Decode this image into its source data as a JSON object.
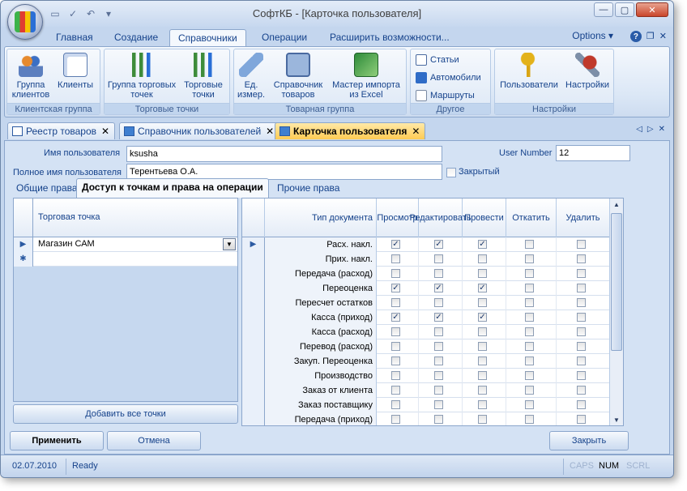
{
  "window": {
    "title": "СофтКБ - [Карточка пользователя]",
    "buttons": [
      "—",
      "▢",
      "✕"
    ]
  },
  "ribbon_tabs": [
    "Главная",
    "Создание",
    "Справочники",
    "Операции",
    "Расширить возможности..."
  ],
  "ribbon_options": "Options",
  "ribbon_groups": [
    {
      "label": "Клиентская группа",
      "buttons": [
        "Группа клиентов",
        "Клиенты"
      ]
    },
    {
      "label": "Торговые точки",
      "buttons": [
        "Группа торговых точек",
        "Торговые точки"
      ]
    },
    {
      "label": "Товарная группа",
      "buttons": [
        "Ед. измер.",
        "Справочник товаров",
        "Мастер импорта из Excel"
      ]
    },
    {
      "label": "Другое",
      "buttons": [
        "Статьи",
        "Автомобили",
        "Маршруты"
      ]
    },
    {
      "label": "Настройки",
      "buttons": [
        "Пользователи",
        "Настройки"
      ]
    }
  ],
  "doc_tabs": [
    "Реестр товаров",
    "Справочник пользователей",
    "Карточка пользователя"
  ],
  "form": {
    "username_label": "Имя пользователя",
    "username_value": "ksusha",
    "fullname_label": "Полное имя пользователя",
    "fullname_value": "Терентьева О.А.",
    "user_number_label": "User Number",
    "user_number_value": "12",
    "closed_label": "Закрытый"
  },
  "sub_tabs": [
    "Общие права",
    "Доступ к точкам и права на операции",
    "Прочие права"
  ],
  "points_grid": {
    "column": "Торговая точка",
    "rows": [
      "Магазин САМ"
    ]
  },
  "add_all_points_button": "Добавить все точки",
  "rights_grid": {
    "columns": [
      "Тип документа",
      "Просмотр",
      "Редактировать",
      "Провести",
      "Откатить",
      "Удалить"
    ],
    "rows": [
      {
        "doc": "Расх. накл.",
        "checks": [
          true,
          true,
          true,
          false,
          false
        ]
      },
      {
        "doc": "Прих. накл.",
        "checks": [
          false,
          false,
          false,
          false,
          false
        ]
      },
      {
        "doc": "Передача (расход)",
        "checks": [
          false,
          false,
          false,
          false,
          false
        ]
      },
      {
        "doc": "Переоценка",
        "checks": [
          true,
          true,
          true,
          false,
          false
        ]
      },
      {
        "doc": "Пересчет остатков",
        "checks": [
          false,
          false,
          false,
          false,
          false
        ]
      },
      {
        "doc": "Касса (приход)",
        "checks": [
          true,
          true,
          true,
          false,
          false
        ]
      },
      {
        "doc": "Касса (расход)",
        "checks": [
          false,
          false,
          false,
          false,
          false
        ]
      },
      {
        "doc": "Перевод (расход)",
        "checks": [
          false,
          false,
          false,
          false,
          false
        ]
      },
      {
        "doc": "Закуп. Переоценка",
        "checks": [
          false,
          false,
          false,
          false,
          false
        ]
      },
      {
        "doc": "Производство",
        "checks": [
          false,
          false,
          false,
          false,
          false
        ]
      },
      {
        "doc": "Заказ от клиента",
        "checks": [
          false,
          false,
          false,
          false,
          false
        ]
      },
      {
        "doc": "Заказ поставщику",
        "checks": [
          false,
          false,
          false,
          false,
          false
        ]
      },
      {
        "doc": "Передача (приход)",
        "checks": [
          false,
          false,
          false,
          false,
          false
        ]
      }
    ]
  },
  "buttons": {
    "apply": "Применить",
    "cancel": "Отмена",
    "close": "Закрыть"
  },
  "status": {
    "date": "02.07.2010",
    "state": "Ready",
    "caps": "CAPS",
    "num": "NUM",
    "scrl": "SCRL"
  }
}
